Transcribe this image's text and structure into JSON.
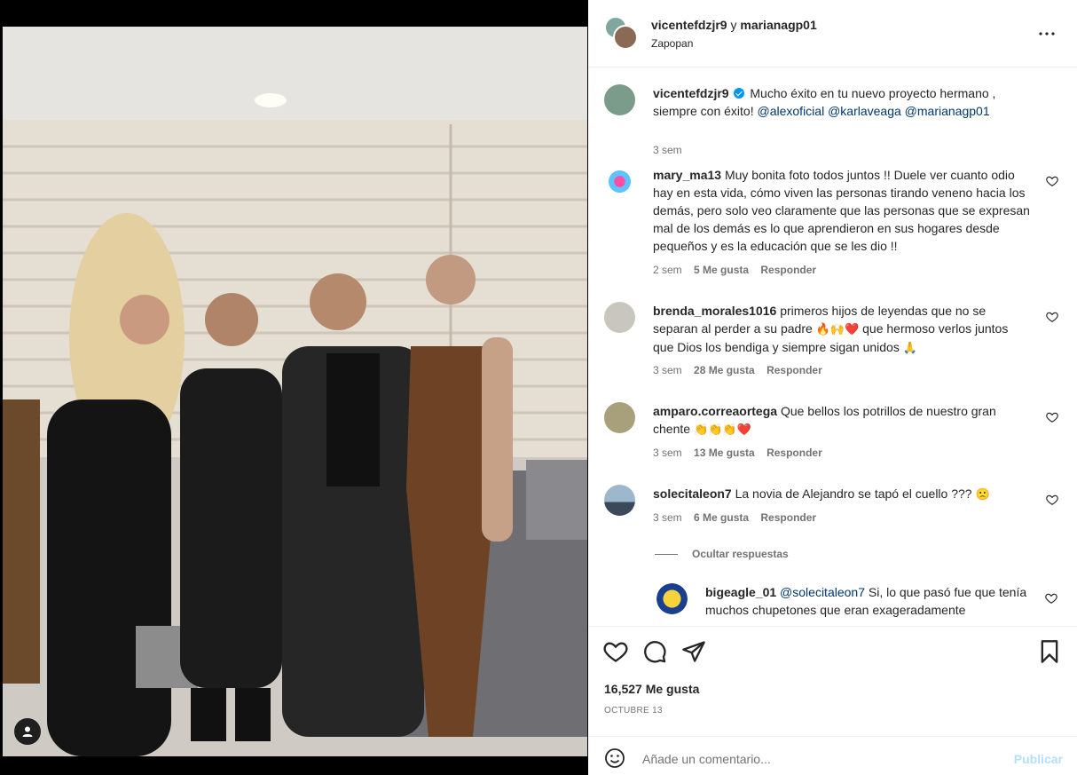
{
  "post": {
    "author_primary": "vicentefdzjr9",
    "connector": "y",
    "author_secondary": "marianagp01",
    "location": "Zapopan",
    "more_icon": "more-horizontal-icon"
  },
  "comments": [
    {
      "user": "vicentefdzjr9",
      "verified": true,
      "text": "Mucho éxito en tu nuevo proyecto hermano , siempre con éxito!",
      "mentions": [
        "@alexoficial",
        "@karlaveaga",
        "@marianagp01"
      ],
      "time": "3 sem"
    },
    {
      "user": "mary_ma13",
      "text": "Muy bonita foto todos juntos !! Duele ver cuanto odio hay en esta vida, cómo viven las personas tirando veneno hacia los demás, pero solo veo claramente que las personas que se expresan mal de los demás es lo que aprendieron en sus hogares desde pequeños y es la educación que se les dio !!",
      "time": "2 sem",
      "likes": "5 Me gusta",
      "reply": "Responder"
    },
    {
      "user": "brenda_morales1016",
      "text_a": "primeros hijos de leyendas que no se separan al perder a su padre",
      "emoji_a": "🔥🙌❤️",
      "text_b": "que hermoso verlos juntos que Dios los bendiga y siempre sigan unidos",
      "emoji_b": "🙏",
      "time": "3 sem",
      "likes": "28 Me gusta",
      "reply": "Responder"
    },
    {
      "user": "amparo.correaortega",
      "text": "Que bellos los potrillos de nuestro gran chente",
      "emoji": "👏👏👏❤️",
      "time": "3 sem",
      "likes": "13 Me gusta",
      "reply": "Responder"
    },
    {
      "user": "solecitaleon7",
      "text": "La novia de Alejandro se tapó el cuello ???",
      "emoji": "🙁",
      "time": "3 sem",
      "likes": "6 Me gusta",
      "reply": "Responder"
    }
  ],
  "hide_replies": "Ocultar respuestas",
  "reply": {
    "user": "bigeagle_01",
    "mention": "@solecitaleon7",
    "text": "Si, lo que pasó fue que tenía muchos chupetones que eran exageradamente"
  },
  "stats": {
    "likes": "16,527 Me gusta",
    "date": "OCTUBRE 13"
  },
  "composer": {
    "placeholder": "Añade un comentario...",
    "publish": "Publicar"
  },
  "colors": {
    "link": "#00376b",
    "verified": "#0095f6",
    "muted": "#737373",
    "publish_disabled": "#b2dffc"
  }
}
